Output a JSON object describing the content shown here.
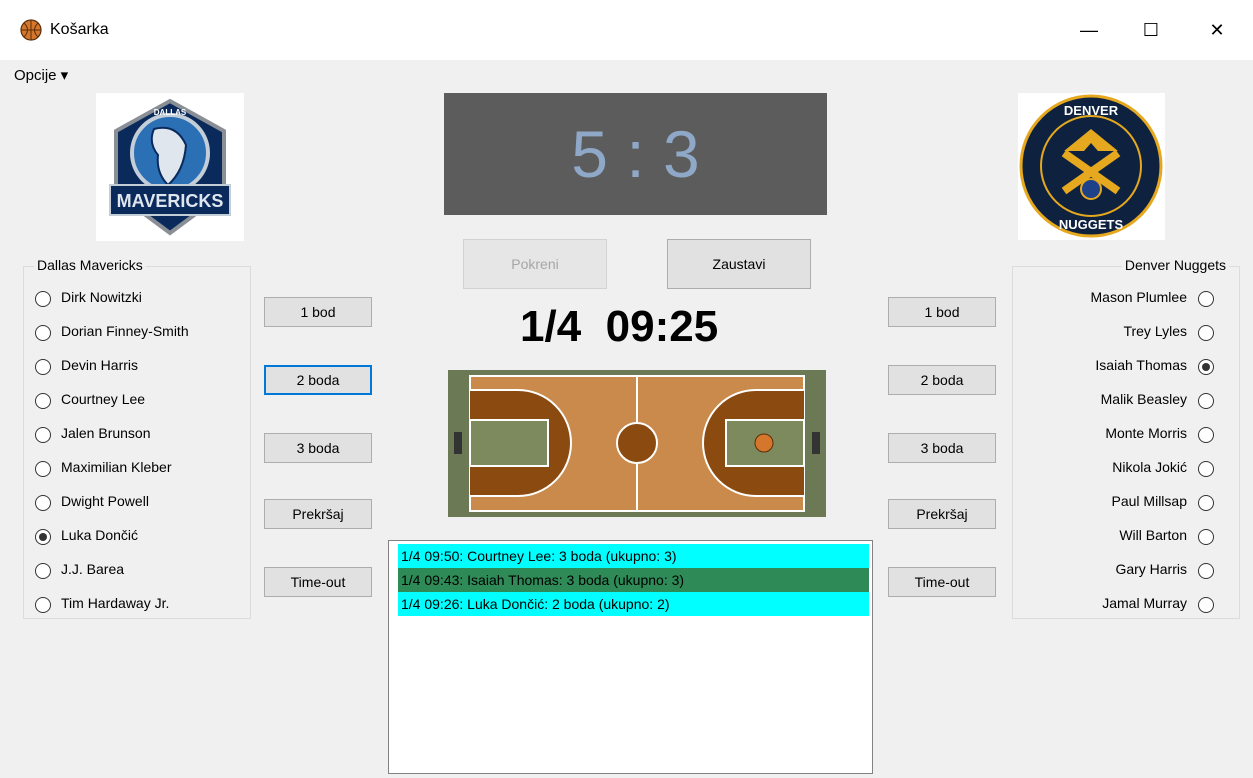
{
  "window": {
    "title": "Košarka",
    "icon": "basketball-icon",
    "controls": {
      "minimize": "—",
      "maximize": "☐",
      "close": "✕"
    }
  },
  "menu": {
    "opcije": "Opcije ▾"
  },
  "score": {
    "home": "5",
    "separator": ":",
    "away": "3"
  },
  "controls": {
    "start_label": "Pokreni",
    "stop_label": "Zaustavi"
  },
  "clock": {
    "quarter": "1/4",
    "time": "09:25"
  },
  "home": {
    "name": "Dallas Mavericks",
    "logo_text": "MAVERICKS",
    "logo_top_text": "DALLAS",
    "players": [
      {
        "name": "Dirk Nowitzki",
        "selected": false
      },
      {
        "name": "Dorian Finney-Smith",
        "selected": false
      },
      {
        "name": "Devin Harris",
        "selected": false
      },
      {
        "name": "Courtney Lee",
        "selected": false
      },
      {
        "name": "Jalen Brunson",
        "selected": false
      },
      {
        "name": "Maximilian Kleber",
        "selected": false
      },
      {
        "name": "Dwight Powell",
        "selected": false
      },
      {
        "name": "Luka Dončić",
        "selected": true
      },
      {
        "name": "J.J. Barea",
        "selected": false
      },
      {
        "name": "Tim Hardaway Jr.",
        "selected": false
      }
    ],
    "buttons": [
      "1 bod",
      "2 boda",
      "3 boda",
      "Prekršaj",
      "Time-out"
    ]
  },
  "away": {
    "name": "Denver Nuggets",
    "logo_text": "DENVER",
    "logo_bottom_text": "NUGGETS",
    "players": [
      {
        "name": "Mason Plumlee",
        "selected": false
      },
      {
        "name": "Trey Lyles",
        "selected": false
      },
      {
        "name": "Isaiah Thomas",
        "selected": true
      },
      {
        "name": "Malik Beasley",
        "selected": false
      },
      {
        "name": "Monte Morris",
        "selected": false
      },
      {
        "name": "Nikola Jokić",
        "selected": false
      },
      {
        "name": "Paul Millsap",
        "selected": false
      },
      {
        "name": "Will Barton",
        "selected": false
      },
      {
        "name": "Gary Harris",
        "selected": false
      },
      {
        "name": "Jamal Murray",
        "selected": false
      }
    ],
    "buttons": [
      "1 bod",
      "2 boda",
      "3 boda",
      "Prekršaj",
      "Time-out"
    ]
  },
  "log": [
    {
      "text": "1/4 09:50: Courtney Lee: 3 boda (ukupno: 3)",
      "color": "#00ffff"
    },
    {
      "text": "1/4 09:43: Isaiah Thomas: 3 boda (ukupno: 3)",
      "color": "#2e8b57"
    },
    {
      "text": "1/4 09:26: Luka Dončić: 2 boda (ukupno: 2)",
      "color": "#00ffff"
    }
  ],
  "colors": {
    "court_wood": "#c98a4b",
    "court_paint": "#8a4a10",
    "court_border": "#6b7a55"
  }
}
